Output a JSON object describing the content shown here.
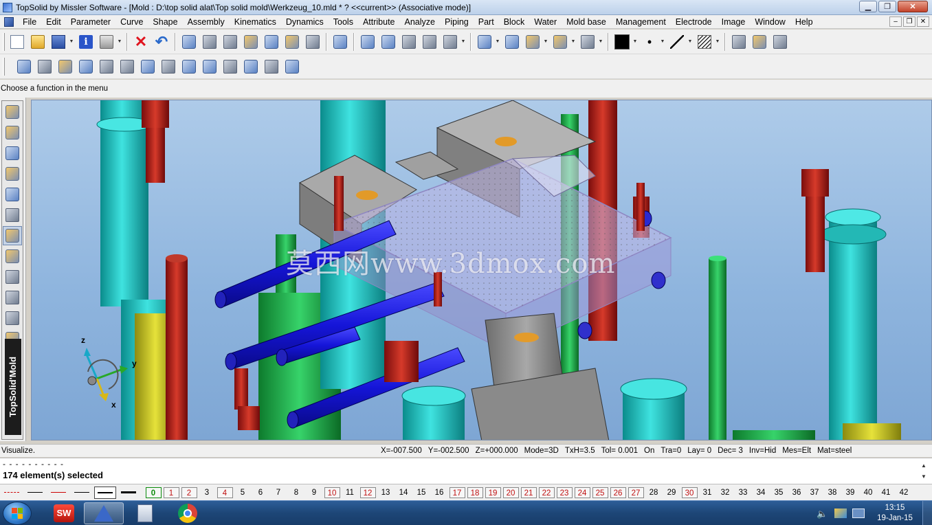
{
  "window": {
    "title": "TopSolid by Missler Software - [Mold : D:\\top solid alat\\Top solid mold\\Werkzeug_10.mld * ?  <<current>> (Associative mode)]",
    "controls": [
      "minimize",
      "maximize",
      "close"
    ]
  },
  "menu": {
    "items": [
      "File",
      "Edit",
      "Parameter",
      "Curve",
      "Shape",
      "Assembly",
      "Kinematics",
      "Dynamics",
      "Tools",
      "Attribute",
      "Analyze",
      "Piping",
      "Part",
      "Block",
      "Water",
      "Mold base",
      "Management",
      "Electrode",
      "Image",
      "Window",
      "Help"
    ]
  },
  "toolbar1": {
    "buttons": [
      "new-file-icon",
      "open-folder-icon",
      "save-icon",
      "info-icon",
      "print-icon",
      "delete-icon",
      "undo-icon",
      "update-icon",
      "view-icon",
      "parameters-icon",
      "hammer-icon",
      "magnet-icon",
      "lasso-icon",
      "edit-icon",
      "analyze-icon",
      "pick-icon",
      "measure-icon",
      "tool-icon",
      "curve-icon",
      "zoom-icon",
      "fit-view-icon",
      "render-icon",
      "shading-icon",
      "color-swatch",
      "point-style",
      "line-style",
      "hatch-style",
      "camera-icon",
      "rotate-icon",
      "cube-icon"
    ],
    "current_color": "#000000"
  },
  "toolbar2": {
    "buttons": [
      "punch-icon",
      "plate-icon",
      "insert-icon",
      "pin-icon",
      "slider-icon",
      "ejector-icon",
      "block-icon",
      "cavity-icon",
      "core-icon",
      "cooling-icon",
      "screw-icon",
      "support-icon",
      "guide-icon",
      "lifter-icon"
    ]
  },
  "prompt": {
    "text": "Choose a function in the menu"
  },
  "left_toolbar": {
    "buttons": [
      "sketch-icon",
      "curve-tool-icon",
      "solid-icon",
      "surface-icon",
      "assembly-tool-icon",
      "part-tool-icon",
      "mold-tool-icon",
      "electrode-tool-icon",
      "drafting-icon",
      "bolt-icon",
      "ejector-pin-icon",
      "cooling-tool-icon",
      "standard-parts-icon",
      "catalog-icon"
    ],
    "brand": "TopSolid'Mold"
  },
  "viewport": {
    "watermark": "莫西网www.3dmox.com",
    "axes": {
      "z": "z",
      "y": "y",
      "x": "x"
    }
  },
  "status": {
    "message": "Visualize.",
    "fields": [
      "X=-007.500",
      "Y=-002.500",
      "Z=+000.000",
      "Mode=3D",
      "TxH=3.5",
      "Tol= 0.001",
      "On",
      "Tra=0",
      "Lay=  0",
      "Dec= 3",
      "Inv=Hid",
      "Mes=Elt",
      "Mat=steel"
    ]
  },
  "command": {
    "dashes": "- - - - - - - - - -",
    "selection": "174 element(s) selected"
  },
  "layers": {
    "current": "0",
    "numbers": [
      "0",
      "1",
      "2",
      "3",
      "4",
      "5",
      "6",
      "7",
      "8",
      "9",
      "10",
      "11",
      "12",
      "13",
      "14",
      "15",
      "16",
      "17",
      "18",
      "19",
      "20",
      "21",
      "22",
      "23",
      "24",
      "25",
      "26",
      "27",
      "28",
      "29",
      "30",
      "31",
      "32",
      "33",
      "34",
      "35",
      "36",
      "37",
      "38",
      "39",
      "40",
      "41",
      "42"
    ],
    "used": [
      "1",
      "2",
      "4",
      "10",
      "12",
      "17",
      "18",
      "19",
      "20",
      "21",
      "22",
      "23",
      "24",
      "25",
      "26",
      "27",
      "30"
    ]
  },
  "taskbar": {
    "apps": [
      "solidworks-app-icon",
      "topsolid-app-icon",
      "calculator-app-icon",
      "chrome-app-icon"
    ],
    "clock": {
      "time": "13:15",
      "date": "19-Jan-15"
    }
  }
}
